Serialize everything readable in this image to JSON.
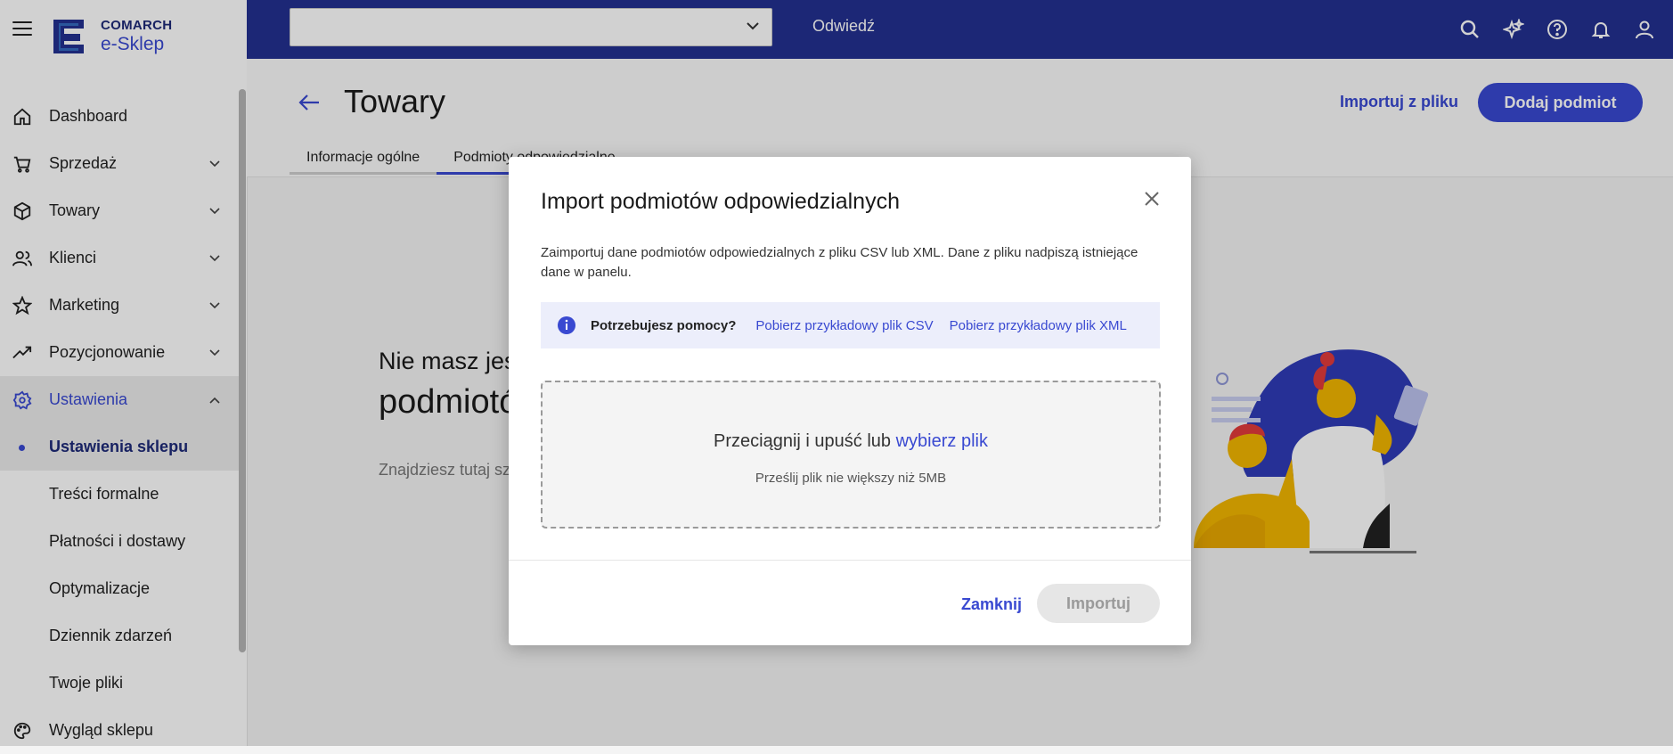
{
  "brand": {
    "company": "COMARCH",
    "product": "e-Sklep"
  },
  "topbar": {
    "store_select_value": "",
    "visit_label": "Odwiedź",
    "icons": [
      "search-icon",
      "sparkle-icon",
      "help-icon",
      "bell-icon",
      "user-icon"
    ]
  },
  "sidebar": {
    "items": [
      {
        "label": "Dashboard",
        "icon": "home-icon"
      },
      {
        "label": "Sprzedaż",
        "icon": "cart-icon"
      },
      {
        "label": "Towary",
        "icon": "box-icon"
      },
      {
        "label": "Klienci",
        "icon": "people-icon"
      },
      {
        "label": "Marketing",
        "icon": "star-icon"
      },
      {
        "label": "Pozycjonowanie",
        "icon": "trending-icon"
      },
      {
        "label": "Ustawienia",
        "icon": "gear-icon"
      }
    ],
    "subitems": [
      {
        "label": "Ustawienia sklepu"
      },
      {
        "label": "Treści formalne"
      },
      {
        "label": "Płatności i dostawy"
      },
      {
        "label": "Optymalizacje"
      },
      {
        "label": "Dziennik zdarzeń"
      },
      {
        "label": "Twoje pliki"
      }
    ],
    "bottom_item": {
      "label": "Wygląd sklepu",
      "icon": "palette-icon"
    }
  },
  "header": {
    "title": "Towary",
    "import_link": "Importuj z pliku",
    "add_button": "Dodaj podmiot",
    "tabs": [
      {
        "label": "Informacje ogólne"
      },
      {
        "label": "Podmioty odpowiedzialne"
      }
    ]
  },
  "empty_state": {
    "line1": "Nie masz jeszcze",
    "line2": "podmiotów odpowiedzialnych",
    "line3": "Znajdziesz tutaj szczegóły o producentach i osobach odpowiedzialnych w e-Sklepie"
  },
  "modal": {
    "title": "Import podmiotów odpowiedzialnych",
    "description": "Zaimportuj dane podmiotów odpowiedzialnych z pliku CSV lub XML. Dane z pliku nadpiszą istniejące dane w panelu.",
    "help_label": "Potrzebujesz pomocy?",
    "help_csv": "Pobierz przykładowy plik CSV",
    "help_xml": "Pobierz przykładowy plik XML",
    "dropzone_text": "Przeciągnij i upuść lub ",
    "dropzone_link": "wybierz plik",
    "dropzone_hint": "Prześlij plik nie większy niż 5MB",
    "close_button": "Zamknij",
    "import_button": "Importuj"
  },
  "colors": {
    "accent": "#3949d1",
    "topbar": "#233090"
  }
}
